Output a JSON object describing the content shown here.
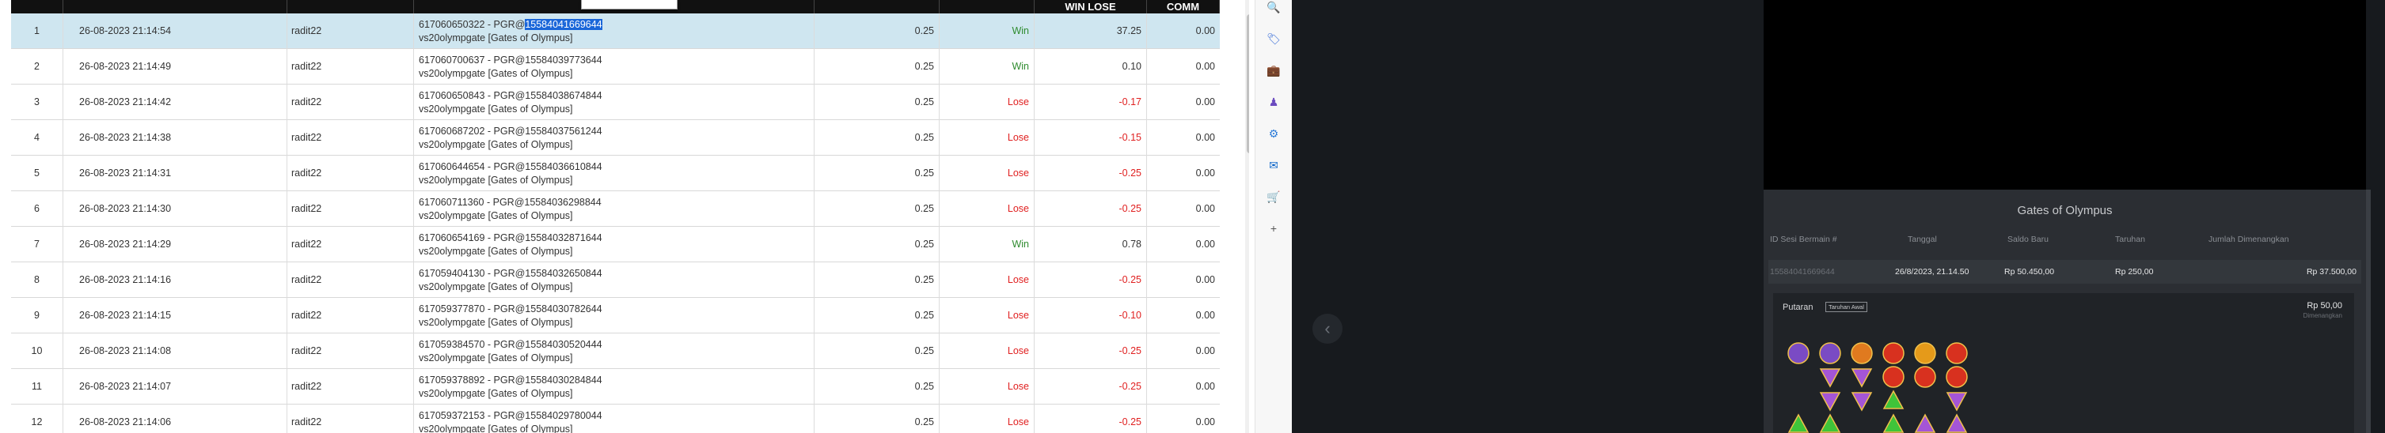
{
  "table": {
    "columns": [
      "",
      "",
      "",
      "",
      "",
      "",
      "WIN LOSE",
      "COMM"
    ],
    "rows": [
      {
        "no": "1",
        "date": "26-08-2023 21:14:54",
        "user": "radit22",
        "game_id_pre": "617060650322 - PGR@",
        "game_id_sel": "15584041669644",
        "game_name": "vs20olympgate [Gates of Olympus]",
        "bet": "0.25",
        "result": "Win",
        "winlose": "37.25",
        "comm": "0.00"
      },
      {
        "no": "2",
        "date": "26-08-2023 21:14:49",
        "user": "radit22",
        "game_id_pre": "617060700637 - PGR@15584039773644",
        "game_id_sel": "",
        "game_name": "vs20olympgate [Gates of Olympus]",
        "bet": "0.25",
        "result": "Win",
        "winlose": "0.10",
        "comm": "0.00"
      },
      {
        "no": "3",
        "date": "26-08-2023 21:14:42",
        "user": "radit22",
        "game_id_pre": "617060650843 - PGR@15584038674844",
        "game_id_sel": "",
        "game_name": "vs20olympgate [Gates of Olympus]",
        "bet": "0.25",
        "result": "Lose",
        "winlose": "-0.17",
        "comm": "0.00"
      },
      {
        "no": "4",
        "date": "26-08-2023 21:14:38",
        "user": "radit22",
        "game_id_pre": "617060687202 - PGR@15584037561244",
        "game_id_sel": "",
        "game_name": "vs20olympgate [Gates of Olympus]",
        "bet": "0.25",
        "result": "Lose",
        "winlose": "-0.15",
        "comm": "0.00"
      },
      {
        "no": "5",
        "date": "26-08-2023 21:14:31",
        "user": "radit22",
        "game_id_pre": "617060644654 - PGR@15584036610844",
        "game_id_sel": "",
        "game_name": "vs20olympgate [Gates of Olympus]",
        "bet": "0.25",
        "result": "Lose",
        "winlose": "-0.25",
        "comm": "0.00"
      },
      {
        "no": "6",
        "date": "26-08-2023 21:14:30",
        "user": "radit22",
        "game_id_pre": "617060711360 - PGR@15584036298844",
        "game_id_sel": "",
        "game_name": "vs20olympgate [Gates of Olympus]",
        "bet": "0.25",
        "result": "Lose",
        "winlose": "-0.25",
        "comm": "0.00"
      },
      {
        "no": "7",
        "date": "26-08-2023 21:14:29",
        "user": "radit22",
        "game_id_pre": "617060654169 - PGR@15584032871644",
        "game_id_sel": "",
        "game_name": "vs20olympgate [Gates of Olympus]",
        "bet": "0.25",
        "result": "Win",
        "winlose": "0.78",
        "comm": "0.00"
      },
      {
        "no": "8",
        "date": "26-08-2023 21:14:16",
        "user": "radit22",
        "game_id_pre": "617059404130 - PGR@15584032650844",
        "game_id_sel": "",
        "game_name": "vs20olympgate [Gates of Olympus]",
        "bet": "0.25",
        "result": "Lose",
        "winlose": "-0.25",
        "comm": "0.00"
      },
      {
        "no": "9",
        "date": "26-08-2023 21:14:15",
        "user": "radit22",
        "game_id_pre": "617059377870 - PGR@15584030782644",
        "game_id_sel": "",
        "game_name": "vs20olympgate [Gates of Olympus]",
        "bet": "0.25",
        "result": "Lose",
        "winlose": "-0.10",
        "comm": "0.00"
      },
      {
        "no": "10",
        "date": "26-08-2023 21:14:08",
        "user": "radit22",
        "game_id_pre": "617059384570 - PGR@15584030520444",
        "game_id_sel": "",
        "game_name": "vs20olympgate [Gates of Olympus]",
        "bet": "0.25",
        "result": "Lose",
        "winlose": "-0.25",
        "comm": "0.00"
      },
      {
        "no": "11",
        "date": "26-08-2023 21:14:07",
        "user": "radit22",
        "game_id_pre": "617059378892 - PGR@15584030284844",
        "game_id_sel": "",
        "game_name": "vs20olympgate [Gates of Olympus]",
        "bet": "0.25",
        "result": "Lose",
        "winlose": "-0.25",
        "comm": "0.00"
      },
      {
        "no": "12",
        "date": "26-08-2023 21:14:06",
        "user": "radit22",
        "game_id_pre": "617059372153 - PGR@15584029780044",
        "game_id_sel": "",
        "game_name": "vs20olympgate [Gates of Olympus]",
        "bet": "0.25",
        "result": "Lose",
        "winlose": "-0.25",
        "comm": "0.00"
      }
    ]
  },
  "side_icons": [
    "search-icon",
    "tag-icon",
    "toolbox-icon",
    "chess-icon",
    "settings-icon",
    "outlook-icon",
    "cart-icon",
    "plus-icon"
  ],
  "game": {
    "title": "Gates of Olympus",
    "headers": [
      "ID Sesi Bermain #",
      "Tanggal",
      "Saldo Baru",
      "Taruhan",
      "Jumlah Dimenangkan"
    ],
    "row": {
      "session": "15584041669644",
      "date": "26/8/2023, 21.14.50",
      "balance": "Rp 50.450,00",
      "bet": "Rp 250,00",
      "won": "Rp 37.500,00"
    },
    "spin_label": "Putaran",
    "spin_tag": "Taruhan Awal",
    "spin_amount": "Rp 50,00",
    "spin_won_label": "Dimenangkan"
  },
  "colors": {
    "win": "#2e8b2e",
    "lose": "#e02020",
    "selected_row": "#cfe6f0",
    "highlight": "#1a66d9"
  }
}
